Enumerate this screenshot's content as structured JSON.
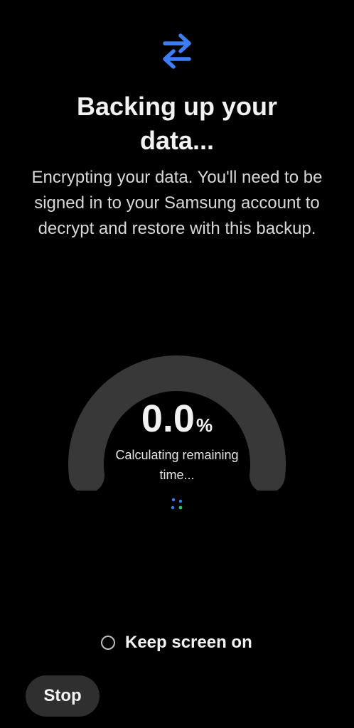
{
  "header": {
    "icon": "transfer-arrows-icon",
    "accent_color": "#3d7ef7",
    "title_line1": "Backing up your",
    "title_line2": "data...",
    "description": "Encrypting your data. You'll need to be signed in to your Samsung account to decrypt and restore with this backup."
  },
  "progress": {
    "percent_value": "0.0",
    "percent_unit": "%",
    "fraction": 0.0,
    "status_line1": "Calculating remaining",
    "status_line2": "time...",
    "track_color": "#383838"
  },
  "options": {
    "keep_screen_on_label": "Keep screen on",
    "keep_screen_on_checked": false
  },
  "footer": {
    "stop_label": "Stop"
  }
}
